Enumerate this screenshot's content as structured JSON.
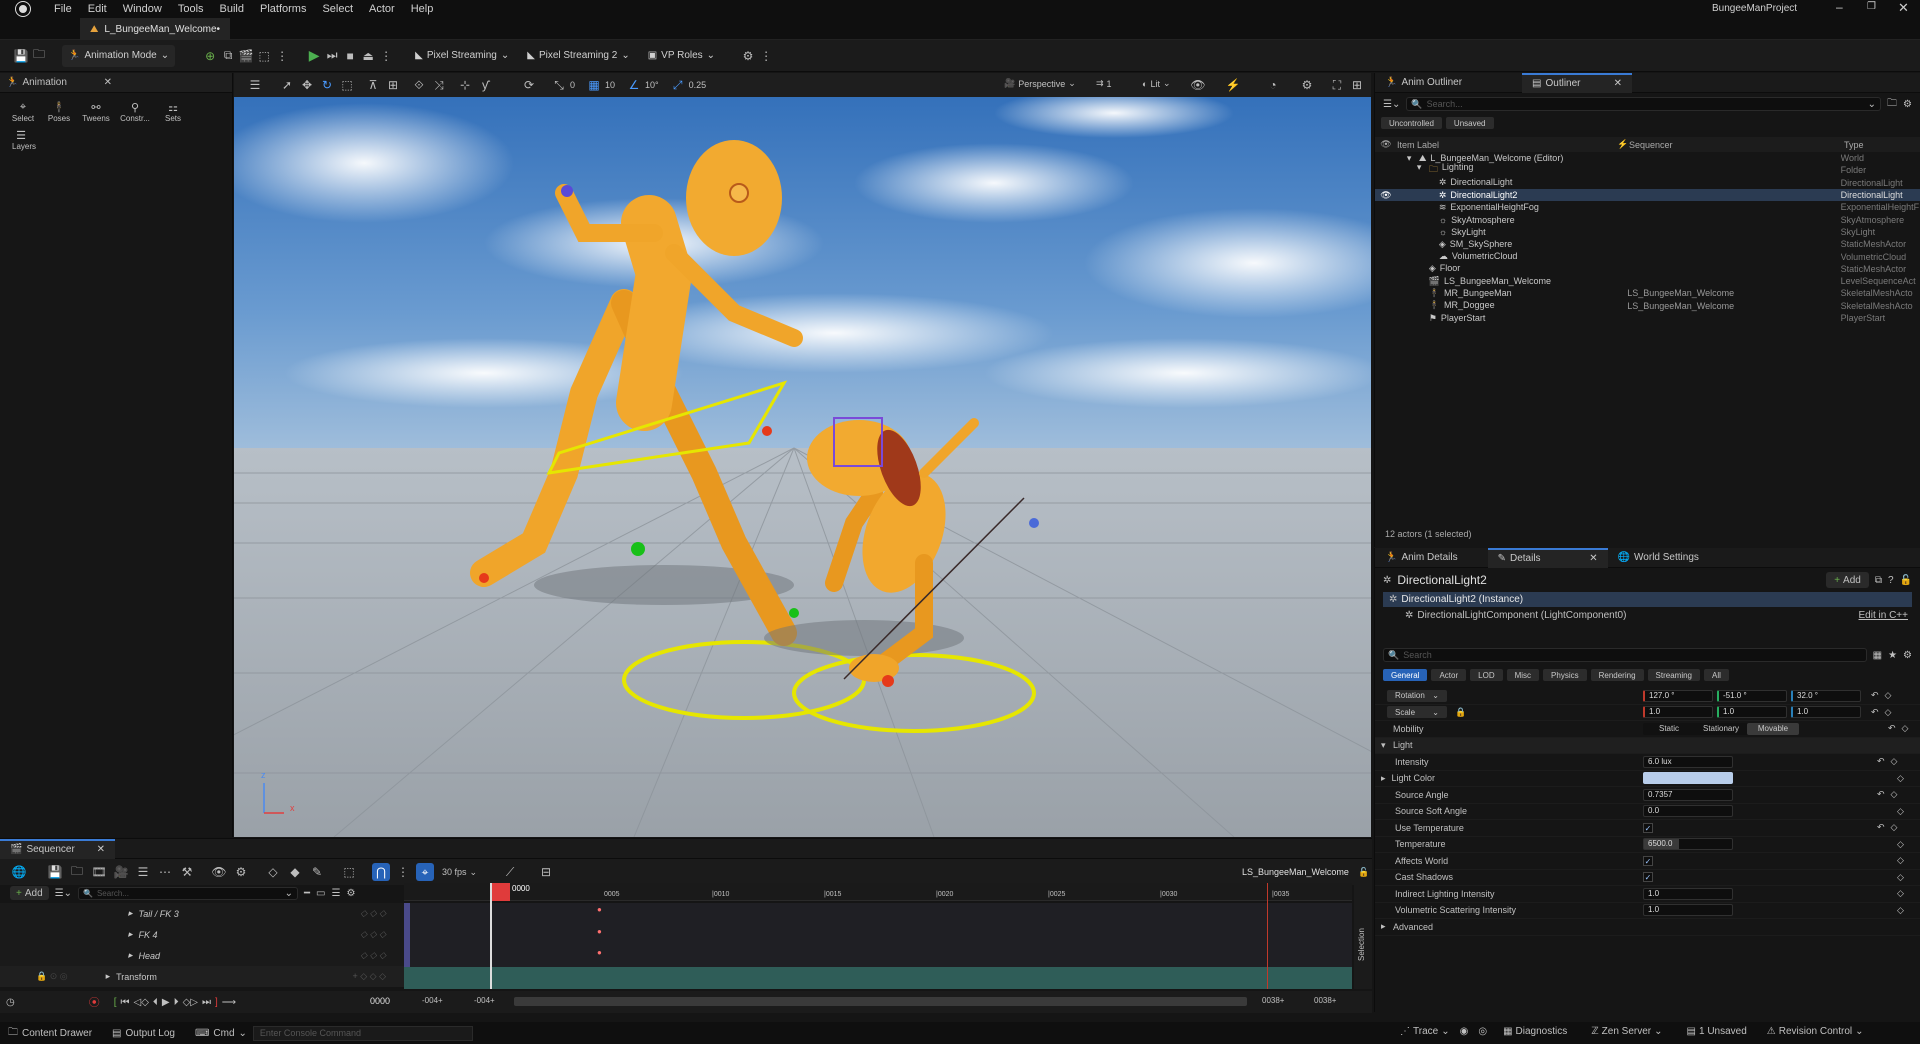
{
  "app": {
    "project_name": "BungeeManProject",
    "menu": [
      "File",
      "Edit",
      "Window",
      "Tools",
      "Build",
      "Platforms",
      "Select",
      "Actor",
      "Help"
    ],
    "level_tab": "L_BungeeMan_Welcome•"
  },
  "toolbar": {
    "mode_label": "Animation Mode",
    "pixel_streaming": "Pixel Streaming",
    "pixel_streaming2": "Pixel Streaming 2",
    "vp_roles": "VP Roles"
  },
  "animation_panel": {
    "tab": "Animation",
    "tools": [
      "Select",
      "Poses",
      "Tweens",
      "Constr...",
      "Sets"
    ],
    "layers": "Layers"
  },
  "viewport": {
    "perspective": "Perspective",
    "lit": "Lit",
    "angle_snap": "0",
    "grid_snap": "10",
    "rot_snap": "10°",
    "scale_snap": "0.25",
    "speed": "1",
    "axis_x": "x",
    "axis_z": "z"
  },
  "outliner": {
    "tab1": "Anim Outliner",
    "tab2": "Outliner",
    "search_placeholder": "Search...",
    "filter_uncontrolled": "Uncontrolled",
    "filter_unsaved": "Unsaved",
    "col_label": "Item Label",
    "col_sequencer": "Sequencer",
    "col_type": "Type",
    "items": [
      {
        "indent": 1,
        "label": "L_BungeeMan_Welcome (Editor)",
        "seq": "",
        "type": "World",
        "icon": "world"
      },
      {
        "indent": 2,
        "label": "Lighting",
        "seq": "",
        "type": "Folder",
        "icon": "folder"
      },
      {
        "indent": 3,
        "label": "DirectionalLight",
        "seq": "",
        "type": "DirectionalLight",
        "icon": "light"
      },
      {
        "indent": 3,
        "label": "DirectionalLight2",
        "seq": "",
        "type": "DirectionalLight",
        "icon": "light",
        "selected": true
      },
      {
        "indent": 3,
        "label": "ExponentialHeightFog",
        "seq": "",
        "type": "ExponentialHeightF",
        "icon": "fog"
      },
      {
        "indent": 3,
        "label": "SkyAtmosphere",
        "seq": "",
        "type": "SkyAtmosphere",
        "icon": "sky"
      },
      {
        "indent": 3,
        "label": "SkyLight",
        "seq": "",
        "type": "SkyLight",
        "icon": "sky"
      },
      {
        "indent": 3,
        "label": "SM_SkySphere",
        "seq": "",
        "type": "StaticMeshActor",
        "icon": "mesh"
      },
      {
        "indent": 3,
        "label": "VolumetricCloud",
        "seq": "",
        "type": "VolumetricCloud",
        "icon": "cloud"
      },
      {
        "indent": 2,
        "label": "Floor",
        "seq": "",
        "type": "StaticMeshActor",
        "icon": "mesh"
      },
      {
        "indent": 2,
        "label": "LS_BungeeMan_Welcome",
        "seq": "",
        "type": "LevelSequenceAct",
        "icon": "seq"
      },
      {
        "indent": 2,
        "label": "MR_BungeeMan",
        "seq": "LS_BungeeMan_Welcome",
        "type": "SkeletalMeshActo",
        "icon": "skel"
      },
      {
        "indent": 2,
        "label": "MR_Doggee",
        "seq": "LS_BungeeMan_Welcome",
        "type": "SkeletalMeshActo",
        "icon": "skel"
      },
      {
        "indent": 2,
        "label": "PlayerStart",
        "seq": "",
        "type": "PlayerStart",
        "icon": "player"
      }
    ],
    "status": "12 actors (1 selected)"
  },
  "details": {
    "tab1": "Anim Details",
    "tab2": "Details",
    "tab3": "World Settings",
    "object_name": "DirectionalLight2",
    "add_label": "Add",
    "instance": "DirectionalLight2 (Instance)",
    "component": "DirectionalLightComponent (LightComponent0)",
    "edit_cpp": "Edit in C++",
    "search_placeholder": "Search",
    "filters": [
      "General",
      "Actor",
      "LOD",
      "Misc",
      "Physics",
      "Rendering",
      "Streaming",
      "All"
    ],
    "rotation_label": "Rotation",
    "rotation": [
      "127.0 °",
      "-51.0 °",
      "32.0 °"
    ],
    "scale_label": "Scale",
    "scale": [
      "1.0",
      "1.0",
      "1.0"
    ],
    "mobility_label": "Mobility",
    "mobility": [
      "Static",
      "Stationary",
      "Movable"
    ],
    "light_section": "Light",
    "intensity_label": "Intensity",
    "intensity": "6.0 lux",
    "light_color_label": "Light Color",
    "light_color": "#b8cdea",
    "source_angle_label": "Source Angle",
    "source_angle": "0.7357",
    "source_soft_angle_label": "Source Soft Angle",
    "source_soft_angle": "0.0",
    "use_temperature_label": "Use Temperature",
    "temperature_label": "Temperature",
    "temperature": "6500.0",
    "affects_world_label": "Affects World",
    "cast_shadows_label": "Cast Shadows",
    "indirect_label": "Indirect Lighting Intensity",
    "indirect": "1.0",
    "volumetric_label": "Volumetric Scattering Intensity",
    "volumetric": "1.0",
    "advanced": "Advanced"
  },
  "sequencer": {
    "tab": "Sequencer",
    "fps": "30 fps",
    "sequence_name": "LS_BungeeMan_Welcome",
    "add_label": "Add",
    "search_placeholder": "Search...",
    "current_frame": "0000",
    "ticks": [
      "0005",
      "|0010",
      "|0015",
      "|0020",
      "|0025",
      "|0030",
      "|0035"
    ],
    "tracks": [
      "Tail / FK 3",
      "FK 4",
      "Head"
    ],
    "transform": "Transform",
    "selection": "Selection",
    "frame_field": "0000",
    "range_start1": "-004+",
    "range_start2": "-004+",
    "range_end1": "0038+",
    "range_end2": "0038+"
  },
  "statusbar": {
    "content_drawer": "Content Drawer",
    "output_log": "Output Log",
    "cmd": "Cmd",
    "console_placeholder": "Enter Console Command",
    "trace": "Trace",
    "diagnostics": "Diagnostics",
    "zen_server": "Zen Server",
    "unsaved": "1 Unsaved",
    "revision_control": "Revision Control"
  }
}
